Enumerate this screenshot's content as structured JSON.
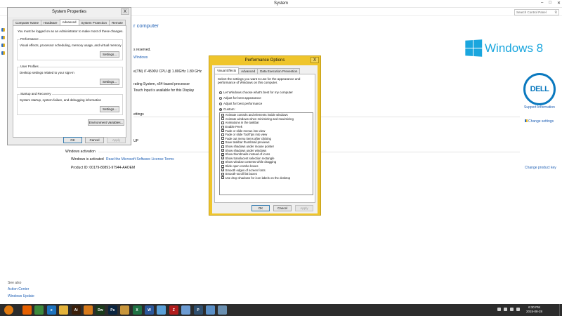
{
  "system_window": {
    "title": "System",
    "search_placeholder": "Search Control Panel",
    "heading_partial": "r computer",
    "rights_partial": "s reserved.",
    "windows_link_partial": "Windows",
    "processor_value": "e(TM) i7-4500U CPU @ 1.80GHz   1.80 GHz",
    "system_type_value": "rating System, x64-based processor",
    "pen_touch_value": "Touch Input is available for this Display",
    "settings_partial": "ettings",
    "workgroup_partial": "UP",
    "activation_heading": "Windows activation",
    "activation_status": "Windows is activated",
    "license_link": "Read the Microsoft Software License Terms",
    "product_id": "Product ID: 00179-80891-97944-AAOEM",
    "change_settings": "Change settings",
    "change_product_key": "Change product key",
    "support_info": "Support Information",
    "see_also": "See also",
    "action_center": "Action Center",
    "windows_update": "Windows Update",
    "win8_logo_text": "Windows 8",
    "dell_logo_text": "DELL"
  },
  "sysprop": {
    "title": "System Properties",
    "close": "X",
    "tabs": [
      "Computer Name",
      "Hardware",
      "Advanced",
      "System Protection",
      "Remote"
    ],
    "admin_note": "You must be logged on as an Administrator to make most of these changes.",
    "groups": [
      {
        "title": "Performance",
        "desc": "Visual effects, processor scheduling, memory usage, and virtual memory",
        "button": "Settings..."
      },
      {
        "title": "User Profiles",
        "desc": "Desktop settings related to your sign-in",
        "button": "Settings..."
      },
      {
        "title": "Startup and Recovery",
        "desc": "System startup, system failure, and debugging information",
        "button": "Settings..."
      }
    ],
    "env_button": "Environment Variables...",
    "ok": "OK",
    "cancel": "Cancel",
    "apply": "Apply"
  },
  "perf": {
    "title": "Performance Options",
    "close": "X",
    "tabs": [
      "Visual Effects",
      "Advanced",
      "Data Execution Prevention"
    ],
    "intro": "Select the settings you want to use for the appearance and performance of Windows on this computer.",
    "radios": [
      {
        "label": "Let Windows choose what's best for my computer",
        "selected": false
      },
      {
        "label": "Adjust for best appearance",
        "selected": false
      },
      {
        "label": "Adjust for best performance",
        "selected": false
      },
      {
        "label": "Custom:",
        "selected": true
      }
    ],
    "effects": [
      {
        "label": "Animate controls and elements inside windows",
        "checked": true
      },
      {
        "label": "Animate windows when minimizing and maximizing",
        "checked": false
      },
      {
        "label": "Animations in the taskbar",
        "checked": false
      },
      {
        "label": "Enable Peek",
        "checked": false
      },
      {
        "label": "Fade or slide menus into view",
        "checked": true
      },
      {
        "label": "Fade or slide ToolTips into view",
        "checked": false
      },
      {
        "label": "Fade out menu items after clicking",
        "checked": false
      },
      {
        "label": "Save taskbar thumbnail previews",
        "checked": false
      },
      {
        "label": "Show shadows under mouse pointer",
        "checked": false
      },
      {
        "label": "Show shadows under windows",
        "checked": true
      },
      {
        "label": "Show thumbnails instead of icons",
        "checked": true
      },
      {
        "label": "Show translucent selection rectangle",
        "checked": true
      },
      {
        "label": "Show window contents while dragging",
        "checked": true
      },
      {
        "label": "Slide open combo boxes",
        "checked": false
      },
      {
        "label": "Smooth edges of screen fonts",
        "checked": true
      },
      {
        "label": "Smooth-scroll list boxes",
        "checked": true
      },
      {
        "label": "Use drop shadows for icon labels on the desktop",
        "checked": true
      }
    ],
    "ok": "OK",
    "cancel": "Cancel",
    "apply": "Apply"
  },
  "taskbar": {
    "apps": [
      {
        "name": "firefox-icon",
        "glyph": "",
        "color": "#e66000"
      },
      {
        "name": "chrome-icon",
        "glyph": "",
        "color": "#3c8a3c"
      },
      {
        "name": "internet-explorer-icon",
        "glyph": "e",
        "color": "#1e73be"
      },
      {
        "name": "file-explorer-icon",
        "glyph": "",
        "color": "#e4b33b"
      },
      {
        "name": "illustrator-icon",
        "glyph": "Ai",
        "color": "#3b1f0a"
      },
      {
        "name": "windows-media-icon",
        "glyph": "",
        "color": "#d77a1b"
      },
      {
        "name": "dreamweaver-icon",
        "glyph": "Dw",
        "color": "#1b3b1b"
      },
      {
        "name": "photoshop-icon",
        "glyph": "Ps",
        "color": "#0b2540"
      },
      {
        "name": "outlook-icon",
        "glyph": "",
        "color": "#c8963c"
      },
      {
        "name": "excel-icon",
        "glyph": "X",
        "color": "#1f7244"
      },
      {
        "name": "word-icon",
        "glyph": "W",
        "color": "#2b579a"
      },
      {
        "name": "paint-icon",
        "glyph": "",
        "color": "#5aa0d8"
      },
      {
        "name": "filezilla-icon",
        "glyph": "Z",
        "color": "#b11c1c"
      },
      {
        "name": "notepad-icon",
        "glyph": "",
        "color": "#6c9bd2"
      },
      {
        "name": "powerpoint-icon",
        "glyph": "P",
        "color": "#2f4f6f"
      },
      {
        "name": "system-window-icon",
        "glyph": "",
        "color": "#5a8fc6"
      },
      {
        "name": "control-panel-icon",
        "glyph": "",
        "color": "#6a8fb0"
      }
    ],
    "time": "6:30 PM",
    "date": "2015-08-28"
  }
}
